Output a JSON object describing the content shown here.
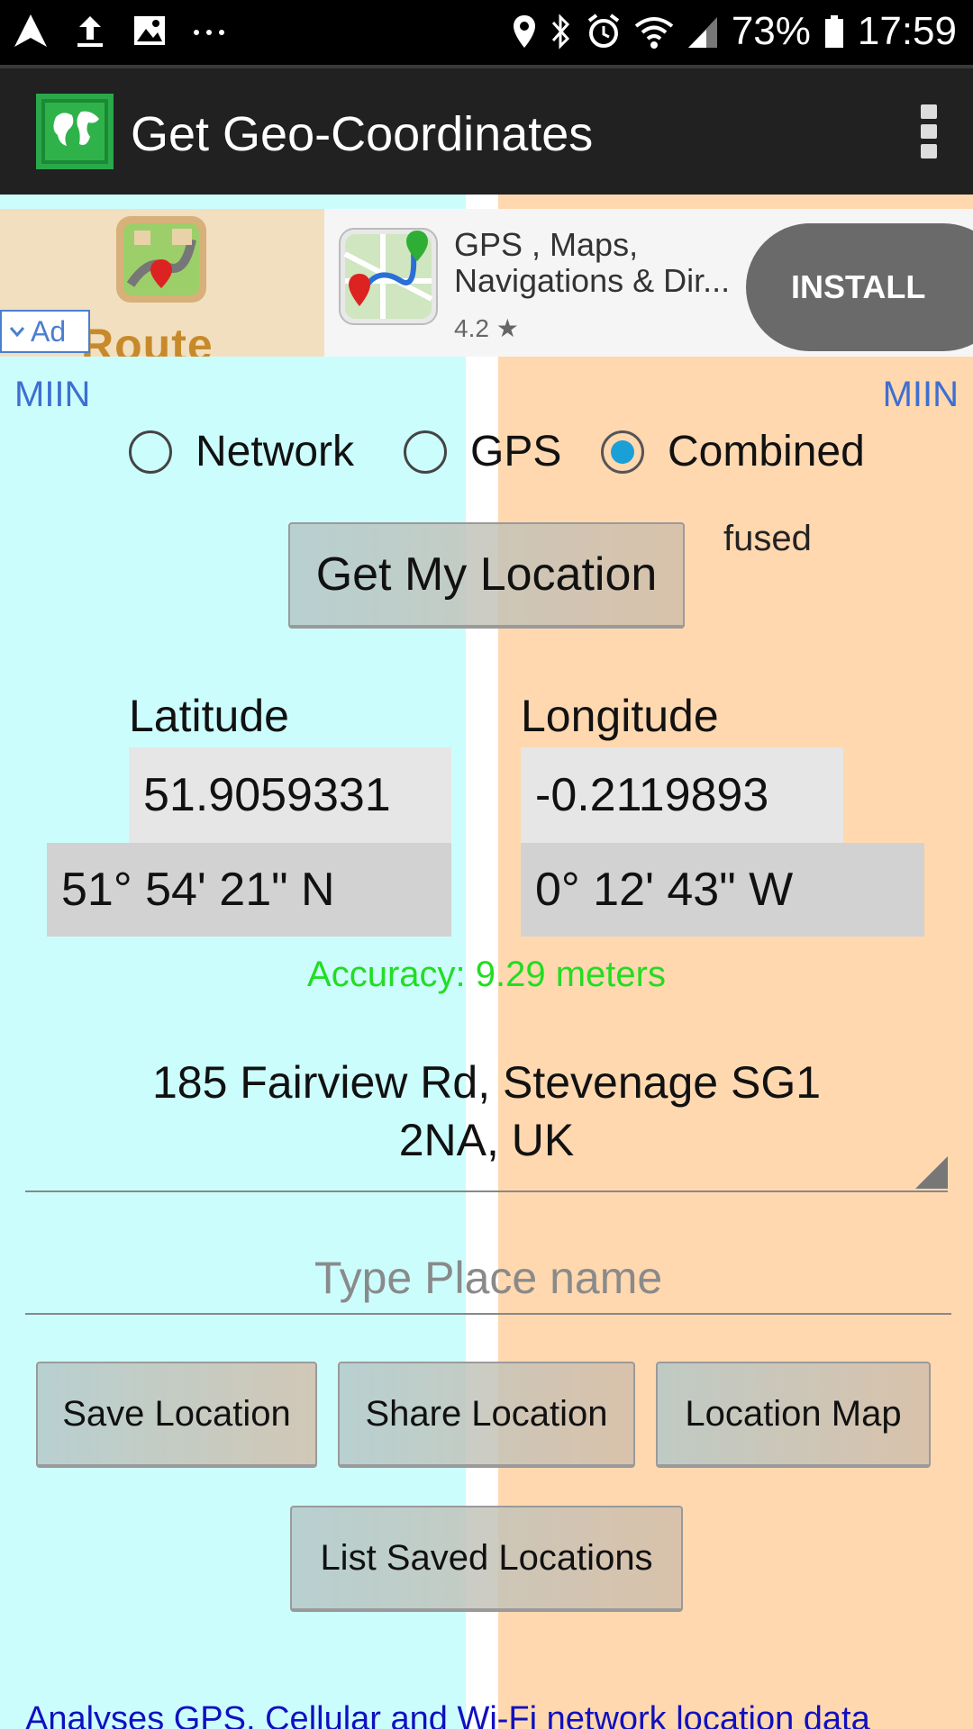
{
  "status_bar": {
    "battery": "73%",
    "time": "17:59",
    "left_icons": [
      "navigation-icon",
      "upload-icon",
      "image-icon",
      "more-horiz-icon"
    ],
    "right_icons": [
      "location-pin-icon",
      "bluetooth-icon",
      "alarm-icon",
      "wifi-icon",
      "signal-icon",
      "battery-icon"
    ]
  },
  "app_bar": {
    "title": "Get Geo-Coordinates"
  },
  "ad": {
    "badge": "Ad",
    "left_banner_text": "Route Finde",
    "title": "GPS , Maps, Navigations & Dir...",
    "rating": "4.2 ★",
    "install": "INSTALL"
  },
  "miin_left": "MIIN",
  "miin_right": "MIIN",
  "provider": {
    "options": [
      "Network",
      "GPS",
      "Combined"
    ],
    "selected": "Combined"
  },
  "get_location_button": "Get My Location",
  "provider_tag": "fused",
  "latitude": {
    "label": "Latitude",
    "decimal": "51.9059331",
    "dms": "51° 54' 21\" N"
  },
  "longitude": {
    "label": "Longitude",
    "decimal": "-0.2119893",
    "dms": "0° 12' 43\" W"
  },
  "accuracy": "Accuracy: 9.29 meters",
  "address": "185 Fairview Rd, Stevenage SG1 2NA, UK",
  "place_input": {
    "placeholder": "Type Place name",
    "value": ""
  },
  "buttons": {
    "save": "Save Location",
    "share": "Share Location",
    "map": "Location Map",
    "list": "List Saved Locations"
  },
  "footer_text": "Analyses GPS, Cellular and Wi-Fi network location data",
  "colors": {
    "left_bg": "#ccfdfd",
    "right_bg": "#ffd8b0",
    "accuracy": "#22dd22",
    "link": "#1010c0",
    "miin": "#3d6fd1"
  }
}
